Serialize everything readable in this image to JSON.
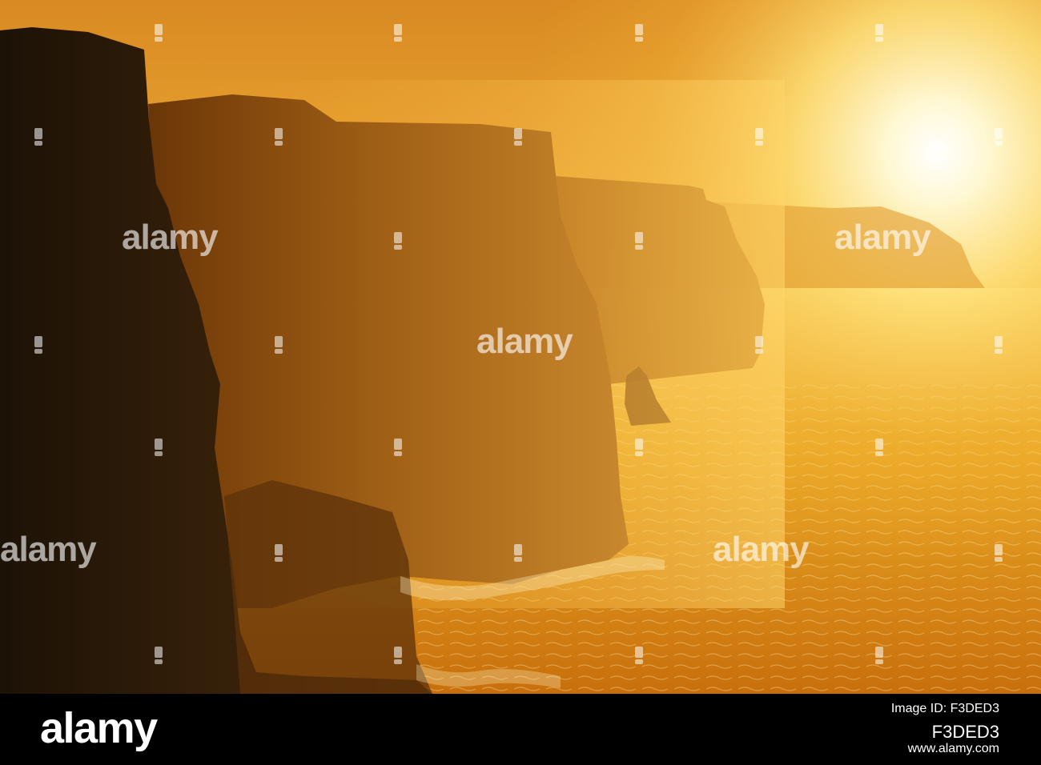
{
  "photo": {
    "subject": "sunset-over-sea-cliffs"
  },
  "watermark": {
    "text": "alamy"
  },
  "footer": {
    "logo": "alamy",
    "code": "F3DED3",
    "line1": "Image ID: F3DED3",
    "line2": "www.alamy.com"
  },
  "colors": {
    "sky_top": "#e89a2a",
    "sun_glow": "#fff6c8",
    "cliff_near": "#2a1a0c",
    "cliff_mid": "#6a3a10",
    "sea": "#e49a1c"
  }
}
